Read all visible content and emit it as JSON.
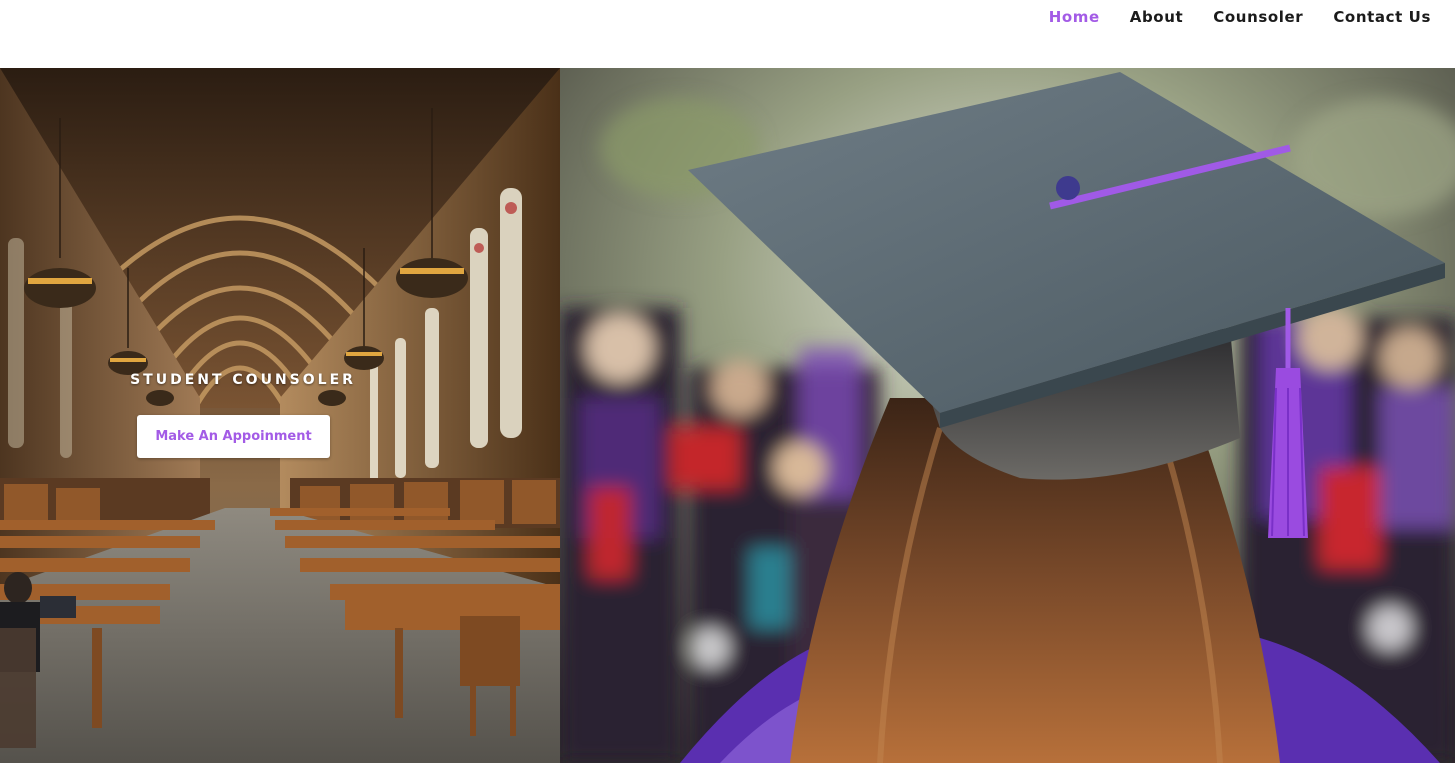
{
  "nav": {
    "items": [
      {
        "label": "Home",
        "active": true
      },
      {
        "label": "About",
        "active": false
      },
      {
        "label": "Counsoler",
        "active": false
      },
      {
        "label": "Contact Us",
        "active": false
      }
    ]
  },
  "hero": {
    "title": "STUDENT COUNSOLER",
    "cta_label": "Make An Appoinment",
    "left_image": "library-hall-image",
    "right_image": "graduation-cap-image"
  },
  "colors": {
    "accent": "#a35be6",
    "nav_text": "#1b1b1b",
    "background": "#ffffff"
  }
}
